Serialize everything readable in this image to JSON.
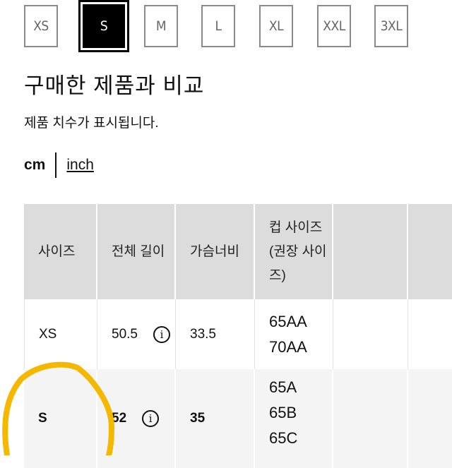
{
  "size_selector": {
    "options": [
      "XS",
      "S",
      "M",
      "L",
      "XL",
      "XXL",
      "3XL"
    ],
    "selected": "S"
  },
  "compare": {
    "heading": "구매한 제품과 비교",
    "subtext": "제품 치수가 표시됩니다.",
    "units": {
      "active": "cm",
      "inactive": "inch"
    }
  },
  "size_table": {
    "headers": [
      "사이즈",
      "전체 길이",
      "가슴너비",
      "컵 사이즈\n(권장 사이\n즈)",
      ""
    ],
    "rows": [
      {
        "size": "XS",
        "total_length": "50.5",
        "chest_width": "33.5",
        "cup_sizes": [
          "65AA",
          "70AA"
        ]
      },
      {
        "size": "S",
        "total_length": "52",
        "chest_width": "35",
        "cup_sizes": [
          "65A",
          "65B",
          "65C"
        ]
      }
    ]
  },
  "annotation": {
    "type": "hand-drawn-circle",
    "target": "S",
    "color": "#F5B800"
  },
  "colors": {
    "header_bg": "#dcdcdc",
    "selected_row_bg": "#f4f4f4",
    "selected_size_bg": "#000000"
  }
}
